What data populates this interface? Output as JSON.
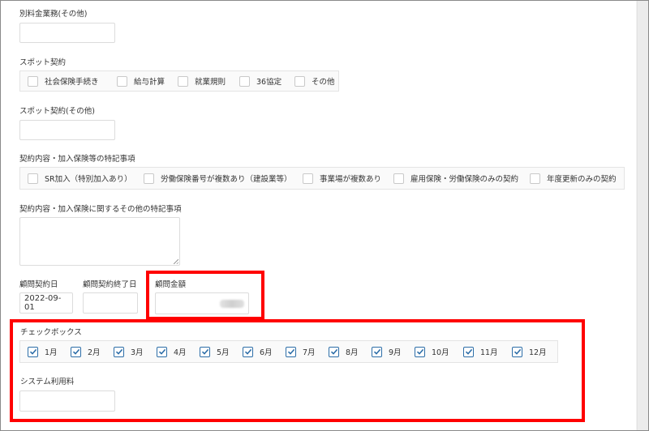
{
  "sections": {
    "special_fee_other": {
      "label": "別料金業務(その他)",
      "value": ""
    },
    "spot_contract": {
      "label": "スポット契約",
      "options": [
        {
          "label": "社会保険手続き",
          "checked": false
        },
        {
          "label": "給与計算",
          "checked": false
        },
        {
          "label": "就業規則",
          "checked": false
        },
        {
          "label": "36協定",
          "checked": false
        },
        {
          "label": "その他",
          "checked": false
        }
      ]
    },
    "spot_contract_other": {
      "label": "スポット契約(その他)",
      "value": ""
    },
    "contract_notes": {
      "label": "契約内容・加入保険等の特記事項",
      "options": [
        {
          "label": "SR加入（特別加入あり）",
          "checked": false
        },
        {
          "label": "労働保険番号が複数あり（建設業等）",
          "checked": false
        },
        {
          "label": "事業場が複数あり",
          "checked": false
        },
        {
          "label": "雇用保険・労働保険のみの契約",
          "checked": false
        },
        {
          "label": "年度更新のみの契約",
          "checked": false
        }
      ]
    },
    "other_notes": {
      "label": "契約内容・加入保険に関するその他の特記事項",
      "value": ""
    },
    "contract_start": {
      "label": "顧問契約日",
      "value": "2022-09-01"
    },
    "contract_end": {
      "label": "顧問契約終了日",
      "value": ""
    },
    "advisory_fee": {
      "label": "顧問金額",
      "value": ""
    },
    "checkbox_months": {
      "label": "チェックボックス",
      "options": [
        {
          "label": "1月",
          "checked": true
        },
        {
          "label": "2月",
          "checked": true
        },
        {
          "label": "3月",
          "checked": true
        },
        {
          "label": "4月",
          "checked": true
        },
        {
          "label": "5月",
          "checked": true
        },
        {
          "label": "6月",
          "checked": true
        },
        {
          "label": "7月",
          "checked": true
        },
        {
          "label": "8月",
          "checked": true
        },
        {
          "label": "9月",
          "checked": true
        },
        {
          "label": "10月",
          "checked": true
        },
        {
          "label": "11月",
          "checked": true
        },
        {
          "label": "12月",
          "checked": true
        }
      ]
    },
    "system_fee": {
      "label": "システム利用料",
      "value": ""
    }
  },
  "colors": {
    "highlight": "#ff0000",
    "check_accent": "#2d6ea8"
  },
  "icons": {
    "checkmark": "check-icon",
    "resize": "resize-grip-icon"
  }
}
